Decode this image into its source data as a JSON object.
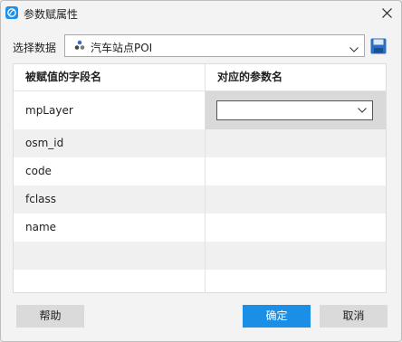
{
  "window": {
    "title": "参数赋属性"
  },
  "dataset": {
    "label": "选择数据",
    "selected": "汽车站点POI",
    "icon": "point-layer-icon"
  },
  "table": {
    "headers": [
      "被赋值的字段名",
      "对应的参数名"
    ],
    "rows": [
      {
        "field": "mpLayer",
        "param": ""
      },
      {
        "field": "osm_id",
        "param": ""
      },
      {
        "field": "code",
        "param": ""
      },
      {
        "field": "fclass",
        "param": ""
      },
      {
        "field": "name",
        "param": ""
      },
      {
        "field": "",
        "param": ""
      },
      {
        "field": "",
        "param": ""
      }
    ]
  },
  "buttons": {
    "help": "帮助",
    "ok": "确定",
    "cancel": "取消"
  },
  "colors": {
    "accent": "#1b8fe6",
    "window_bg": "#f3f3f3",
    "row_alt": "#f0f0f0"
  }
}
